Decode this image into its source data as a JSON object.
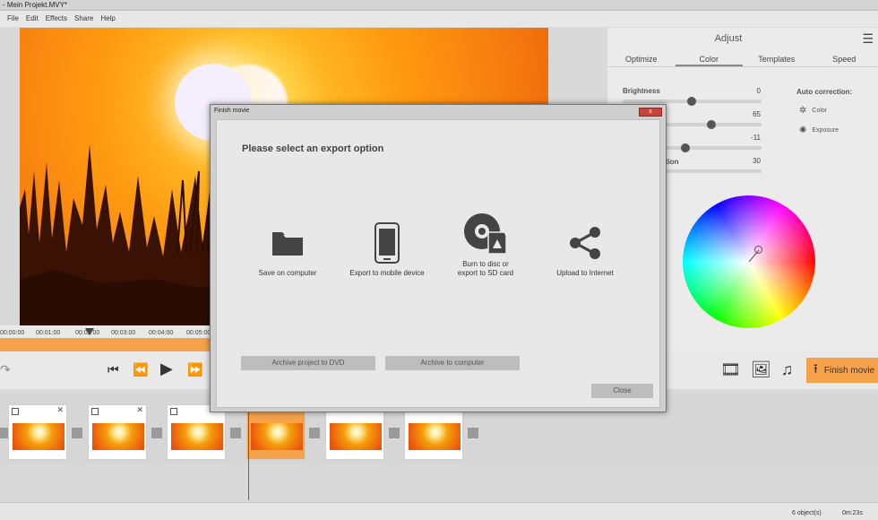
{
  "window": {
    "title": "- Mein Projekt.MVY*"
  },
  "menu": [
    "File",
    "Edit",
    "Effects",
    "Share",
    "Help"
  ],
  "adjust_panel": {
    "title": "Adjust",
    "tabs": [
      "Optimize",
      "Color",
      "Templates",
      "Speed"
    ],
    "active_tab": "Color",
    "sliders": [
      {
        "label": "Brightness",
        "value": "0"
      },
      {
        "label": "",
        "value": "65"
      },
      {
        "label": "",
        "value": "-11"
      },
      {
        "label": "ection",
        "value": "30"
      }
    ],
    "auto_correction": {
      "title": "Auto correction:",
      "items": [
        {
          "label": "Color",
          "icon": "color-balance-icon"
        },
        {
          "label": "Exposure",
          "icon": "exposure-icon"
        }
      ]
    }
  },
  "timeline": {
    "ticks": [
      "00:00:00",
      "00:01:00",
      "00:02:00",
      "00:03:00",
      "00:04:00",
      "00:05:00"
    ]
  },
  "toolbar": {
    "finish_label": "Finish movie",
    "right_icons": [
      "add-video-icon",
      "add-image-icon",
      "add-music-icon"
    ]
  },
  "status": {
    "objects": "6 object(s)",
    "duration": "0m:23s"
  },
  "dialog": {
    "title": "Finish movie",
    "close_x": "x",
    "heading": "Please select an export option",
    "options": [
      {
        "label": "Save on computer",
        "icon": "folder-icon"
      },
      {
        "label": "Export to mobile device",
        "icon": "smartphone-icon"
      },
      {
        "label": "Burn to disc or\nexport to SD card",
        "icon": "disc-sd-icon"
      },
      {
        "label": "Upload to Internet",
        "icon": "share-icon"
      }
    ],
    "archive_dvd": "Archive project to DVD",
    "archive_computer": "Archive to computer",
    "close_button": "Close"
  },
  "colors": {
    "accent": "#f5a24a",
    "dialog_close": "#c8413b"
  }
}
